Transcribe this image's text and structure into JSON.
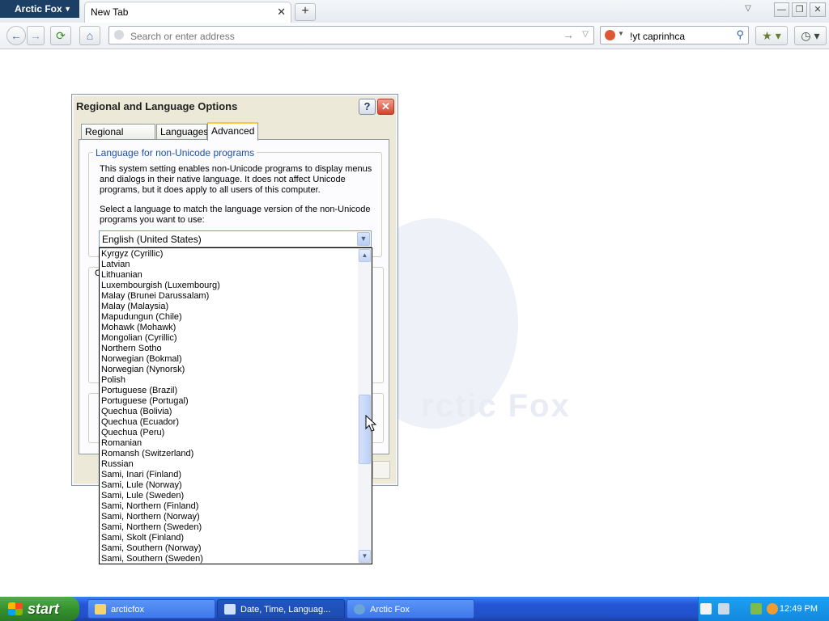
{
  "browser": {
    "app_menu": "Arctic Fox",
    "tab_title": "New Tab",
    "tab_close": "✕",
    "new_tab": "+",
    "url_placeholder": "Search or enter address",
    "search_value": "!yt caprinhca"
  },
  "watermark": {
    "text": "rctic Fox"
  },
  "dialog": {
    "title": "Regional and Language Options",
    "help": "?",
    "close": "✕",
    "tabs": [
      "Regional Options",
      "Languages",
      "Advanced"
    ],
    "active_tab": "Advanced",
    "group_title": "Language for non-Unicode programs",
    "description_lines": [
      "This system setting enables non-Unicode programs to display menus",
      "and dialogs in their native language. It does not affect Unicode",
      "programs, but it does apply to all users of this computer."
    ],
    "select_lines": [
      "Select a language to match the language version of the non-Unicode",
      "programs you want to use:"
    ],
    "selected_language": "English (United States)",
    "ghost_label": "C"
  },
  "dropdown": {
    "items": [
      "Kyrgyz (Cyrillic)",
      "Latvian",
      "Lithuanian",
      "Luxembourgish (Luxembourg)",
      "Malay (Brunei Darussalam)",
      "Malay (Malaysia)",
      "Mapudungun (Chile)",
      "Mohawk (Mohawk)",
      "Mongolian (Cyrillic)",
      "Northern Sotho",
      "Norwegian (Bokmal)",
      "Norwegian (Nynorsk)",
      "Polish",
      "Portuguese (Brazil)",
      "Portuguese (Portugal)",
      "Quechua (Bolivia)",
      "Quechua (Ecuador)",
      "Quechua (Peru)",
      "Romanian",
      "Romansh (Switzerland)",
      "Russian",
      "Sami, Inari (Finland)",
      "Sami, Lule (Norway)",
      "Sami, Lule (Sweden)",
      "Sami, Northern (Finland)",
      "Sami, Northern (Norway)",
      "Sami, Northern (Sweden)",
      "Sami, Skolt (Finland)",
      "Sami, Southern (Norway)",
      "Sami, Southern (Sweden)"
    ]
  },
  "taskbar": {
    "start": "start",
    "tasks": [
      "arcticfox",
      "Date, Time, Languag...",
      "Arctic Fox"
    ],
    "clock": "12:49 PM"
  },
  "colors": {
    "group_title": "#1d50a8",
    "active_tab_accent": "#ffc83c",
    "taskbar": "#2456d6",
    "start_button": "#35932f"
  }
}
